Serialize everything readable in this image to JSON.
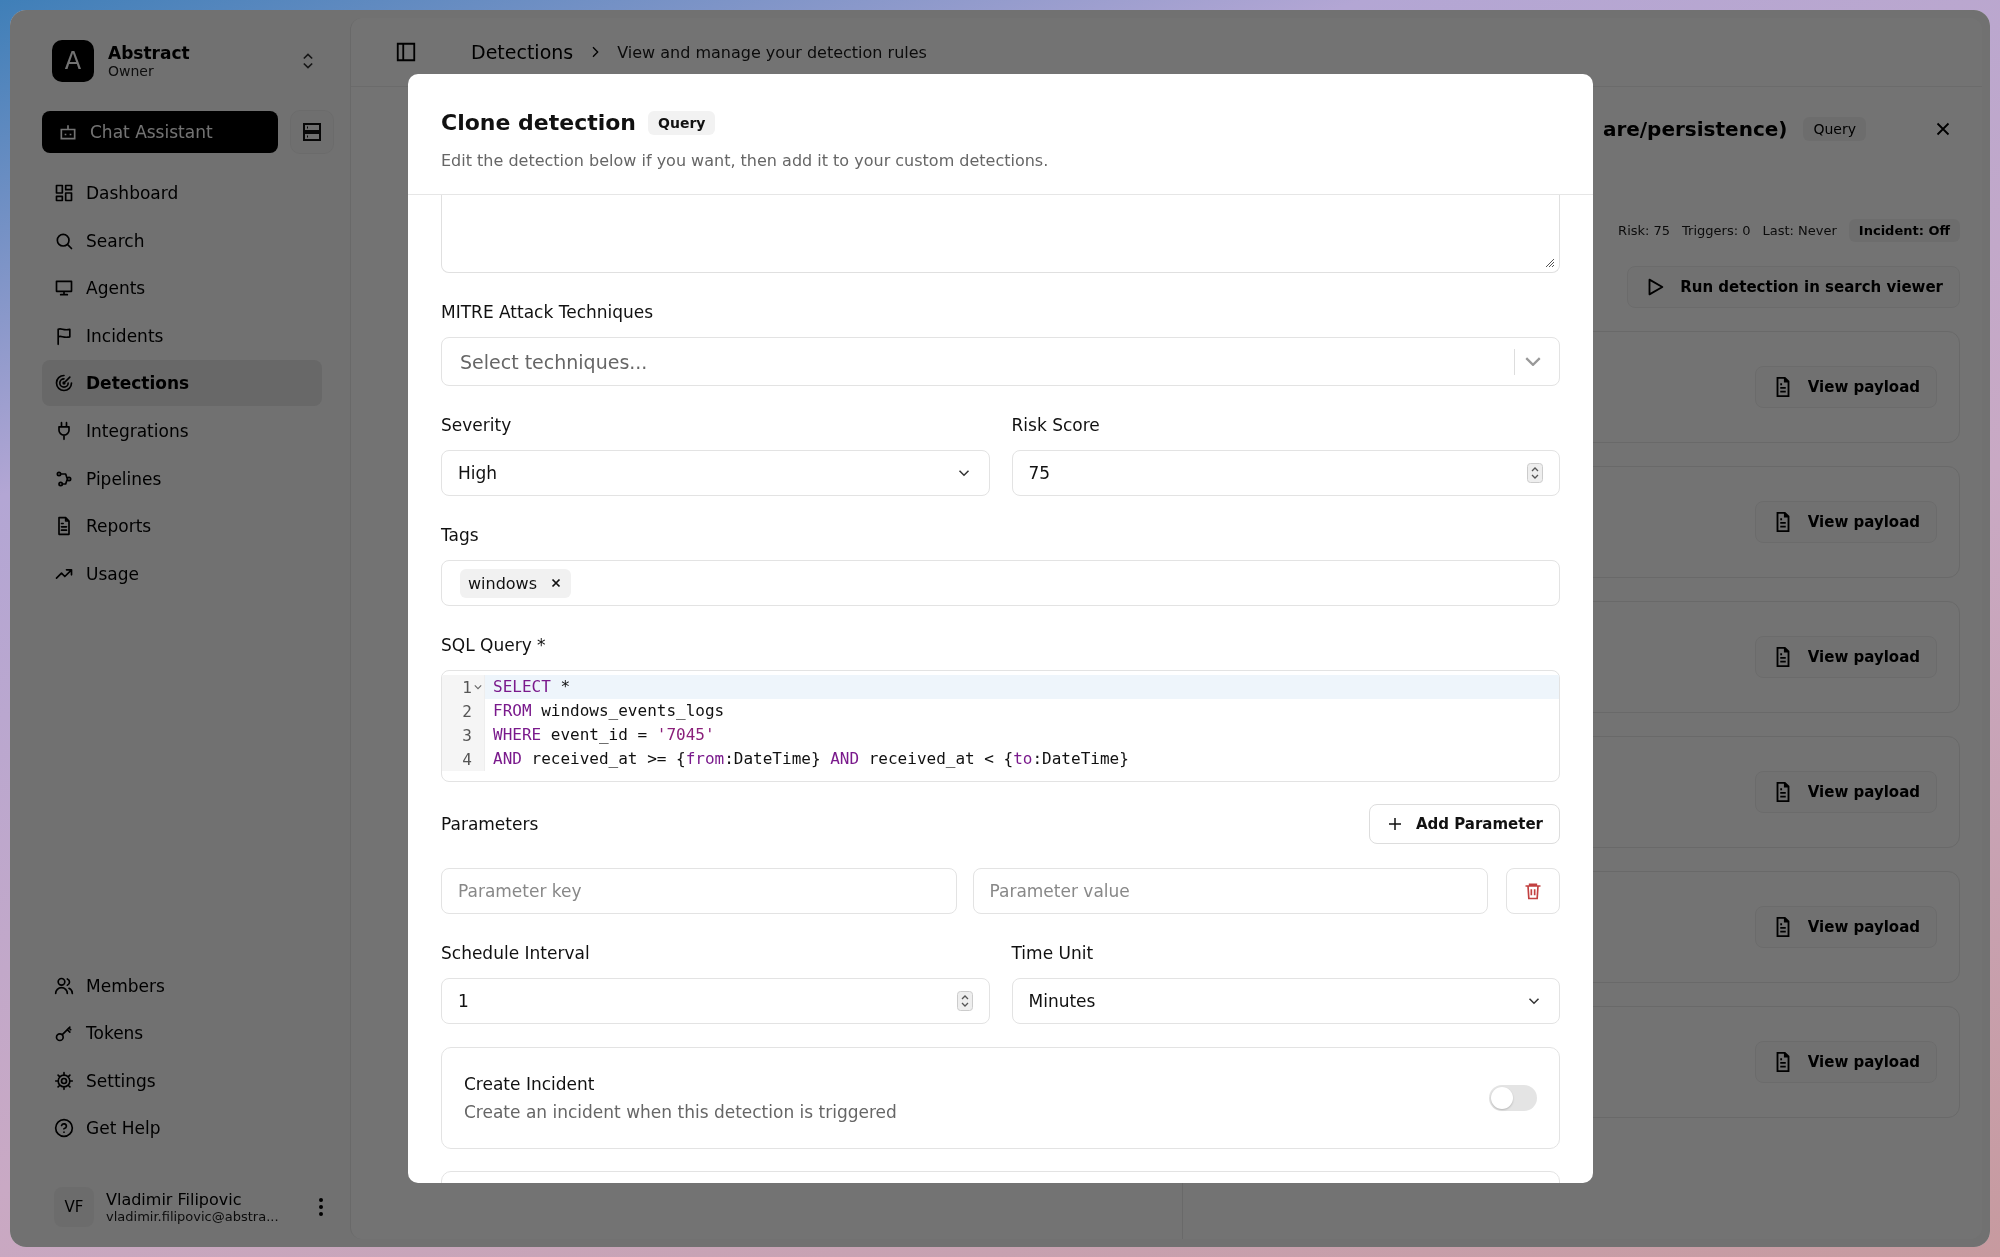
{
  "sidebar": {
    "workspace": {
      "initial": "A",
      "name": "Abstract",
      "role": "Owner"
    },
    "chat_button": "Chat Assistant",
    "nav_items": [
      {
        "label": "Dashboard",
        "selected": false
      },
      {
        "label": "Search",
        "selected": false
      },
      {
        "label": "Agents",
        "selected": false
      },
      {
        "label": "Incidents",
        "selected": false
      },
      {
        "label": "Detections",
        "selected": true
      },
      {
        "label": "Integrations",
        "selected": false
      },
      {
        "label": "Pipelines",
        "selected": false
      },
      {
        "label": "Reports",
        "selected": false
      },
      {
        "label": "Usage",
        "selected": false
      }
    ],
    "bottom_items": [
      {
        "label": "Members",
        "selected": false
      },
      {
        "label": "Tokens",
        "selected": false
      },
      {
        "label": "Settings",
        "selected": false
      },
      {
        "label": "Get Help",
        "selected": false
      }
    ],
    "user": {
      "initials": "VF",
      "name": "Vladimir Filipovic",
      "email": "vladimir.filipovic@abstra..."
    }
  },
  "header": {
    "breadcrumb": [
      "Detections",
      "View and manage your detection rules"
    ]
  },
  "detail_panel": {
    "title": "are/persistence)",
    "badge": "Query",
    "meta": [
      "Risk: 75",
      "Triggers: 0",
      "Last: Never"
    ],
    "incident_badge": "Incident: Off",
    "run_button": "Run detection in search viewer",
    "payload_buttons": [
      "View payload",
      "View payload",
      "View payload",
      "View payload",
      "View payload",
      "View payload"
    ]
  },
  "modal": {
    "title": "Clone detection",
    "badge": "Query",
    "subtitle": "Edit the detection below if you want, then add it to your custom detections.",
    "mitre": {
      "label": "MITRE Attack Techniques",
      "placeholder": "Select techniques..."
    },
    "severity": {
      "label": "Severity",
      "value": "High"
    },
    "risk_score": {
      "label": "Risk Score",
      "value": "75"
    },
    "tags": {
      "label": "Tags",
      "items": [
        "windows"
      ]
    },
    "sql": {
      "label": "SQL Query *",
      "lines": [
        {
          "number": "1",
          "active": true,
          "foldable": true,
          "tokens": [
            {
              "text": "SELECT",
              "kind": "keyword"
            },
            {
              "text": " *",
              "kind": "plain"
            }
          ]
        },
        {
          "number": "2",
          "active": false,
          "foldable": false,
          "tokens": [
            {
              "text": "FROM",
              "kind": "keyword"
            },
            {
              "text": " windows_events_logs",
              "kind": "plain"
            }
          ]
        },
        {
          "number": "3",
          "active": false,
          "foldable": false,
          "tokens": [
            {
              "text": "WHERE",
              "kind": "keyword"
            },
            {
              "text": " event_id = ",
              "kind": "plain"
            },
            {
              "text": "'7045'",
              "kind": "string"
            }
          ]
        },
        {
          "number": "4",
          "active": false,
          "foldable": false,
          "tokens": [
            {
              "text": "AND",
              "kind": "keyword"
            },
            {
              "text": " received_at >= {",
              "kind": "plain"
            },
            {
              "text": "from",
              "kind": "keyword"
            },
            {
              "text": ":DateTime} ",
              "kind": "plain"
            },
            {
              "text": "AND",
              "kind": "keyword"
            },
            {
              "text": " received_at < {",
              "kind": "plain"
            },
            {
              "text": "to",
              "kind": "keyword"
            },
            {
              "text": ":DateTime}",
              "kind": "plain"
            }
          ]
        }
      ]
    },
    "parameters": {
      "label": "Parameters",
      "add_button": "Add Parameter",
      "rows": [
        {
          "key_placeholder": "Parameter key",
          "value_placeholder": "Parameter value"
        }
      ]
    },
    "schedule": {
      "label": "Schedule Interval",
      "value": "1"
    },
    "time_unit": {
      "label": "Time Unit",
      "value": "Minutes"
    },
    "create_incident": {
      "title": "Create Incident",
      "description": "Create an incident when this detection is triggered",
      "on": false
    }
  }
}
